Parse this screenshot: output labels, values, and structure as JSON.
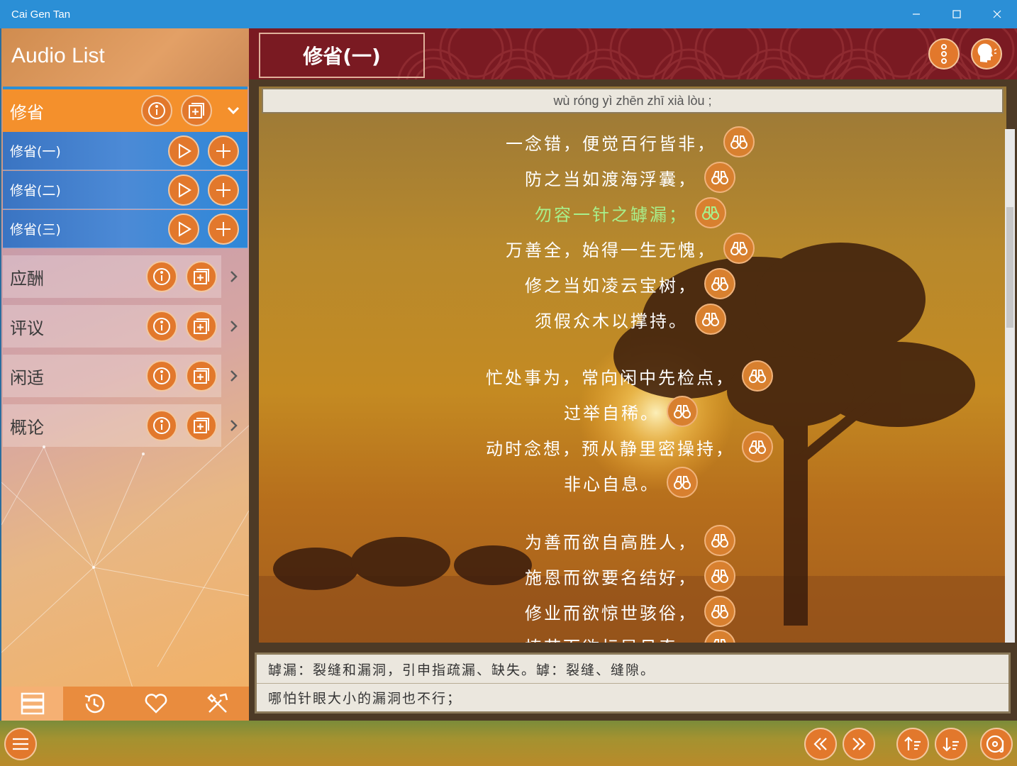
{
  "window": {
    "title": "Cai Gen Tan"
  },
  "sidebar": {
    "title": "Audio List",
    "groups": [
      {
        "label": "修省",
        "expanded": true
      },
      {
        "label": "应酬",
        "expanded": false
      },
      {
        "label": "评议",
        "expanded": false
      },
      {
        "label": "闲适",
        "expanded": false
      },
      {
        "label": "概论",
        "expanded": false
      }
    ],
    "sub_items": [
      {
        "label": "修省(一)"
      },
      {
        "label": "修省(二)"
      },
      {
        "label": "修省(三)"
      }
    ],
    "bottom_tabs": [
      "list-icon",
      "history-icon",
      "heart-icon",
      "tools-icon"
    ]
  },
  "main": {
    "title": "修省(一)",
    "pinyin": "wù róng yì zhēn zhī xià lòu ;",
    "lines": [
      {
        "text": "一念错，便觉百行皆非，",
        "highlight": false
      },
      {
        "text": "防之当如渡海浮囊，",
        "highlight": false
      },
      {
        "text": "勿容一针之罅漏；",
        "highlight": true
      },
      {
        "text": "万善全，始得一生无愧，",
        "highlight": false
      },
      {
        "text": "修之当如凌云宝树，",
        "highlight": false
      },
      {
        "text": "须假众木以撑持。",
        "highlight": false
      },
      {
        "text": "忙处事为，常向闲中先检点，",
        "highlight": false
      },
      {
        "text": "过举自稀。",
        "highlight": false
      },
      {
        "text": "动时念想，预从静里密操持，",
        "highlight": false
      },
      {
        "text": "非心自息。",
        "highlight": false
      },
      {
        "text": "为善而欲自高胜人，",
        "highlight": false
      },
      {
        "text": "施恩而欲要名结好，",
        "highlight": false
      },
      {
        "text": "修业而欲惊世骇俗，",
        "highlight": false
      },
      {
        "text": "植节而欲标异见奇，",
        "highlight": false
      }
    ],
    "notes": [
      "罅漏：裂缝和漏洞，引申指疏漏、缺失。罅：裂缝、缝隙。",
      "哪怕针眼大小的漏洞也不行；"
    ]
  },
  "colors": {
    "accent": "#e2782c",
    "titlebar": "#2b8fd6",
    "header": "#7a1a22",
    "highlight_text": "#a8f08c"
  }
}
